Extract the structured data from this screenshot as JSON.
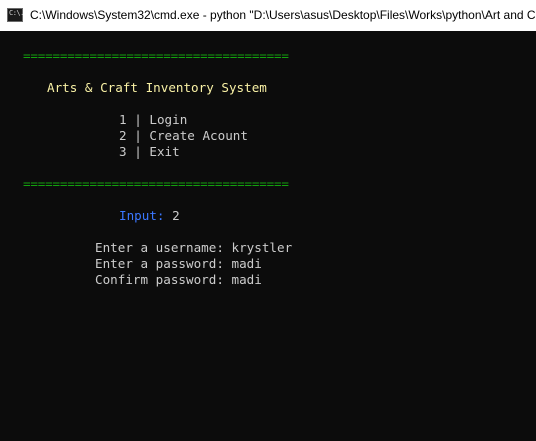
{
  "window": {
    "title": "C:\\Windows\\System32\\cmd.exe - python  \"D:\\Users\\asus\\Desktop\\Files\\Works\\python\\Art and C",
    "icon_name": "cmd-icon",
    "icon_glyph": "C:\\."
  },
  "console": {
    "separator": "====================================",
    "heading": "Arts & Craft Inventory System",
    "menu": [
      {
        "number": "1",
        "bar": "|",
        "label": "Login"
      },
      {
        "number": "2",
        "bar": "|",
        "label": "Create Acount"
      },
      {
        "number": "3",
        "bar": "|",
        "label": "Exit"
      }
    ],
    "input_prompt": "Input:",
    "input_value": "2",
    "fields": [
      {
        "prompt": "Enter a username:",
        "value": "krystler"
      },
      {
        "prompt": "Enter a password:",
        "value": "madi"
      },
      {
        "prompt": "Confirm password:",
        "value": "madi"
      }
    ]
  },
  "colors": {
    "background": "#0c0c0c",
    "text": "#cccccc",
    "separator": "#13a10e",
    "heading": "#f9f1a5",
    "input_prompt": "#3b78ff",
    "titlebar": "#ffffff"
  }
}
